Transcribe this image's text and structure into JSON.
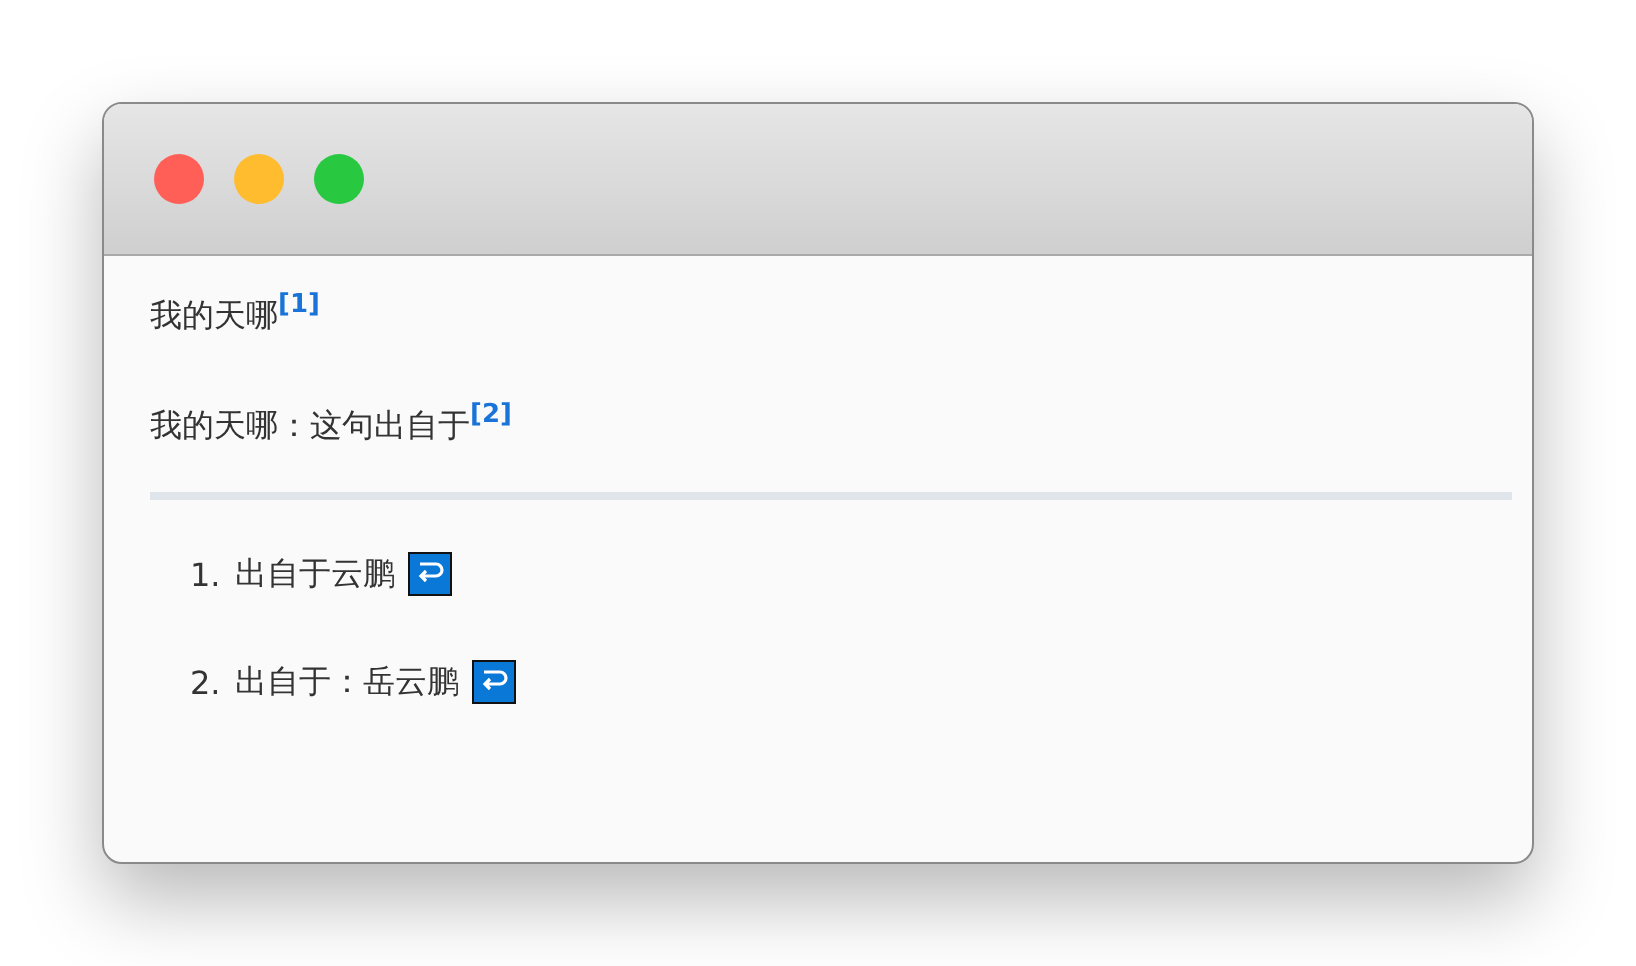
{
  "window": {
    "controls": [
      {
        "color": "#ff5f57"
      },
      {
        "color": "#febc2e"
      },
      {
        "color": "#28c840"
      }
    ]
  },
  "paragraphs": [
    {
      "text": "我的天哪",
      "ref": "[1]"
    },
    {
      "text": "我的天哪：这句出自于",
      "ref": "[2]"
    }
  ],
  "footnotes": [
    {
      "number": "1.",
      "text": "出自于云鹏"
    },
    {
      "number": "2.",
      "text": "出自于：岳云鹏"
    }
  ]
}
